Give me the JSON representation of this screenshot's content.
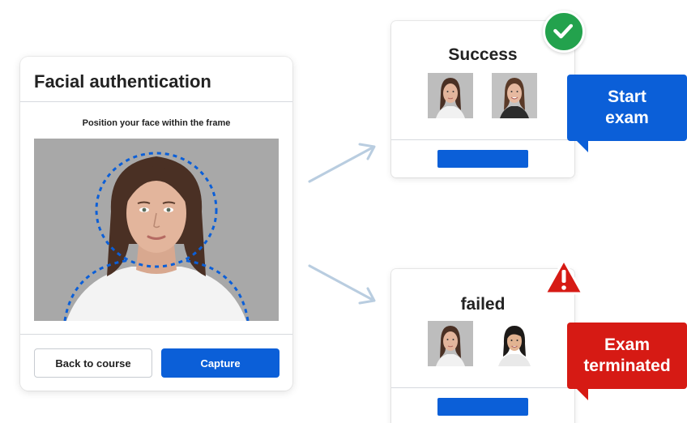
{
  "auth_card": {
    "title": "Facial authentication",
    "instruction": "Position your face within the frame",
    "back_button": "Back to course",
    "capture_button": "Capture"
  },
  "success_result": {
    "title": "Success",
    "callout": "Start\nexam",
    "badge_icon": "checkmark-icon"
  },
  "failed_result": {
    "title": "failed",
    "callout": "Exam\nterminated",
    "badge_icon": "warning-icon"
  },
  "colors": {
    "primary_blue": "#0b5fd8",
    "success_green": "#23a24d",
    "danger_red": "#d61a14",
    "arrow_color": "#b9cde0"
  }
}
